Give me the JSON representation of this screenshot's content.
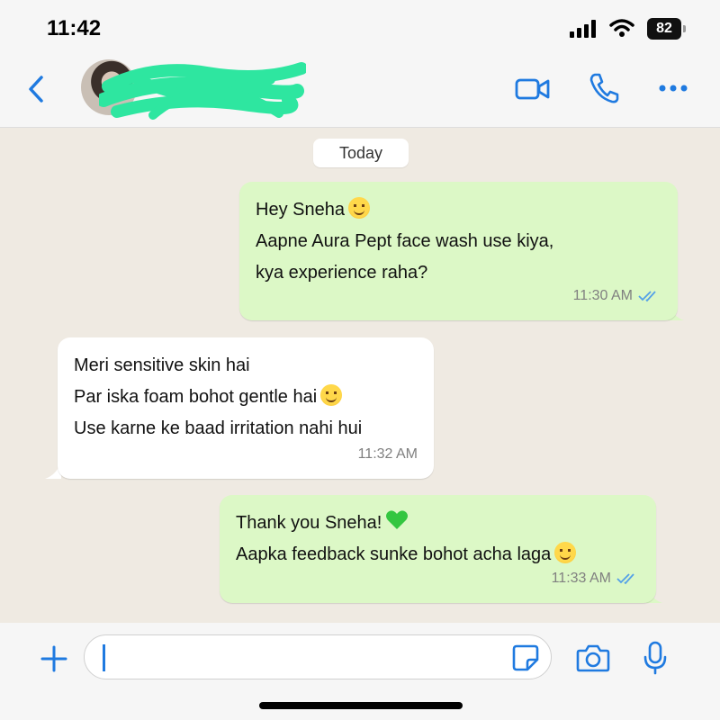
{
  "status_bar": {
    "time": "11:42",
    "battery": "82"
  },
  "header": {
    "icons": [
      "back-icon",
      "video-call-icon",
      "phone-icon",
      "more-icon"
    ],
    "accent_color": "#1f7ae0"
  },
  "chat": {
    "date_label": "Today",
    "messages": [
      {
        "direction": "outgoing",
        "lines": [
          "Hey Sneha",
          "Aapne Aura Pept face wash use kiya,",
          "kya experience raha?"
        ],
        "time": "11:30 AM",
        "read": true
      },
      {
        "direction": "incoming",
        "lines": [
          "Meri sensitive skin hai",
          "Par iska foam bohot gentle hai",
          "Use karne ke baad irritation nahi hui"
        ],
        "time": "11:32 AM"
      },
      {
        "direction": "outgoing",
        "lines": [
          "Thank you Sneha!",
          "Aapka feedback sunke bohot acha laga"
        ],
        "time": "11:33 AM",
        "read": true
      }
    ],
    "colors": {
      "outgoing_bubble": "#dcf8c6",
      "incoming_bubble": "#ffffff",
      "read_ticks": "#53a0e8"
    }
  },
  "composer": {
    "icons": [
      "plus-icon",
      "sticker-icon",
      "camera-icon",
      "microphone-icon"
    ]
  }
}
